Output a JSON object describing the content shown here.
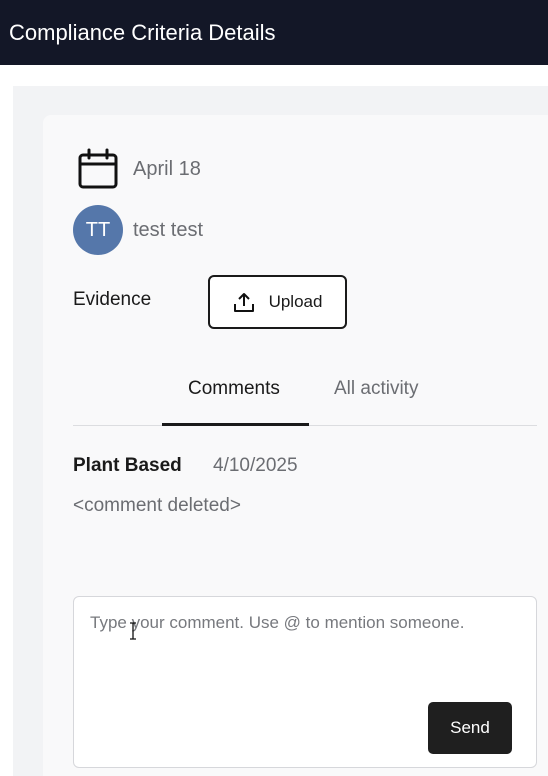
{
  "header": {
    "title": "Compliance Criteria Details"
  },
  "details": {
    "date": "April 18",
    "assignee_initials": "TT",
    "assignee_name": "test test",
    "evidence_label": "Evidence",
    "upload_label": "Upload"
  },
  "tabs": [
    {
      "label": "Comments",
      "active": true
    },
    {
      "label": "All activity",
      "active": false
    }
  ],
  "comments": [
    {
      "author": "Plant Based",
      "date": "4/10/2025",
      "body": "<comment deleted>"
    }
  ],
  "composer": {
    "placeholder": "Type your comment. Use @ to mention someone.",
    "value": "",
    "send_label": "Send"
  },
  "icons": {
    "calendar": "calendar-icon",
    "upload": "upload-icon",
    "cursor": "text-cursor-icon"
  },
  "colors": {
    "header_bg": "#131727",
    "avatar_bg": "#5577aa",
    "send_bg": "#1f1f1f"
  }
}
